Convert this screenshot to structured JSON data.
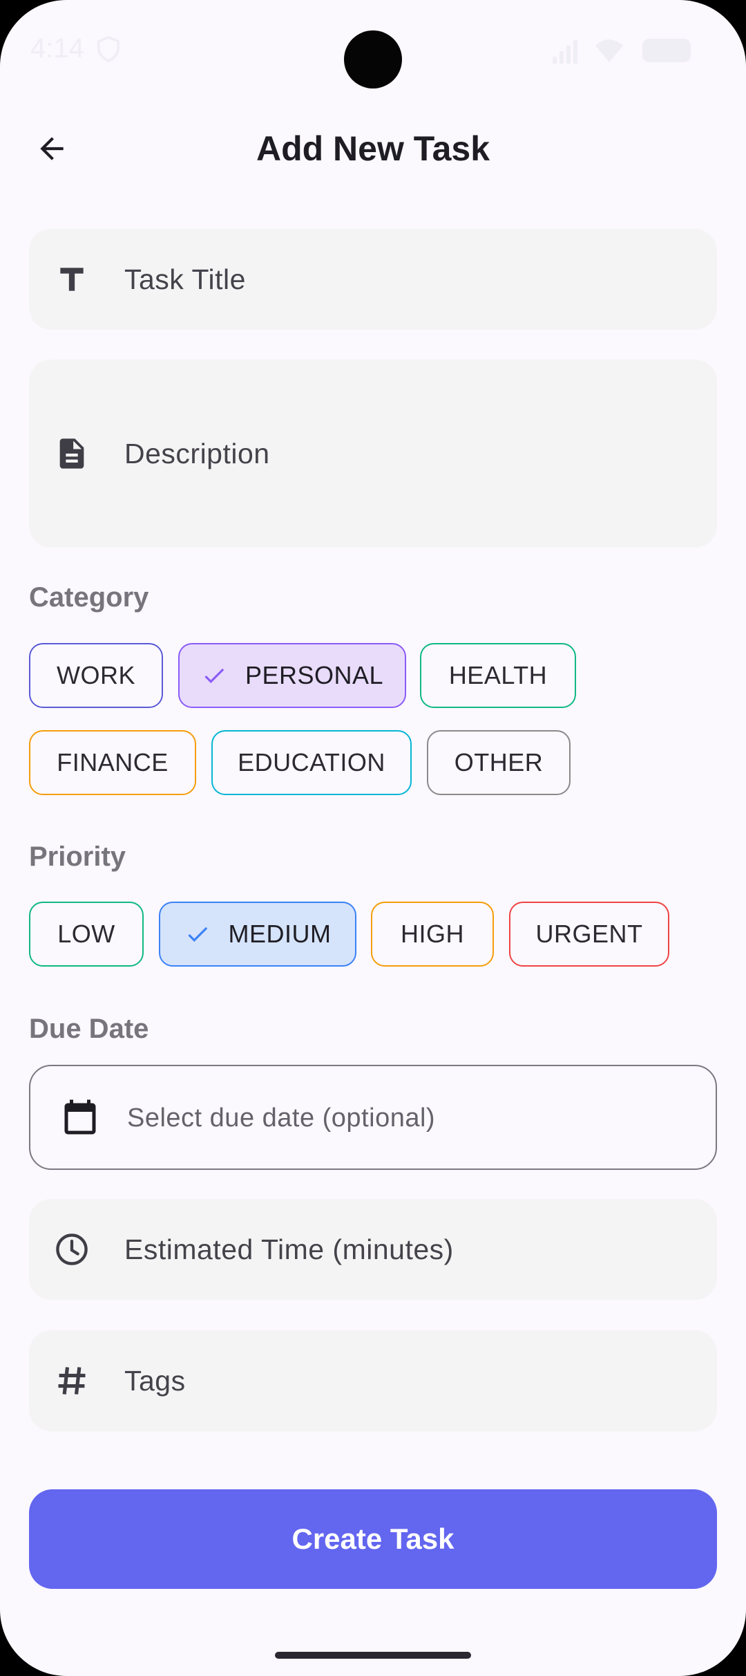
{
  "status_bar": {
    "time": "4:14"
  },
  "header": {
    "title": "Add New Task"
  },
  "fields": {
    "title_placeholder": "Task Title",
    "description_placeholder": "Description",
    "due_date_placeholder": "Select due date (optional)",
    "estimated_time_placeholder": "Estimated Time (minutes)",
    "tags_placeholder": "Tags"
  },
  "category": {
    "label": "Category",
    "selected": "PERSONAL",
    "chips": [
      {
        "label": "WORK",
        "color": "#5b5bd6"
      },
      {
        "label": "PERSONAL",
        "color": "#8b5cf6"
      },
      {
        "label": "HEALTH",
        "color": "#10b981"
      },
      {
        "label": "FINANCE",
        "color": "#f59e0b"
      },
      {
        "label": "EDUCATION",
        "color": "#06b6d4"
      },
      {
        "label": "OTHER",
        "color": "#8a8a8a"
      }
    ]
  },
  "priority": {
    "label": "Priority",
    "selected": "MEDIUM",
    "chips": [
      {
        "label": "LOW",
        "color": "#10b981"
      },
      {
        "label": "MEDIUM",
        "color": "#3b82f6"
      },
      {
        "label": "HIGH",
        "color": "#f59e0b"
      },
      {
        "label": "URGENT",
        "color": "#ef4444"
      }
    ]
  },
  "due_date": {
    "label": "Due Date"
  },
  "actions": {
    "create_label": "Create Task"
  },
  "colors": {
    "accent": "#6366ef",
    "background": "#fbf8fe",
    "field_bg": "#f5f4f5"
  }
}
